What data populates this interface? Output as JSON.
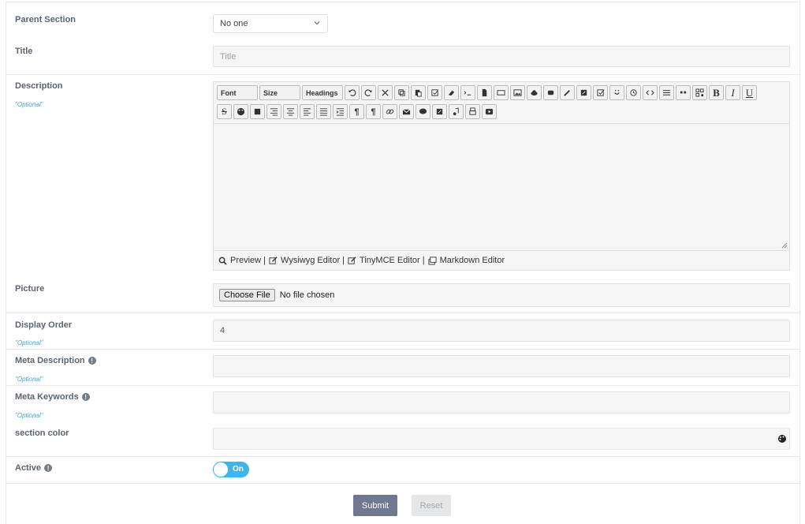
{
  "form": {
    "parent_section": {
      "label": "Parent Section",
      "value": "No one"
    },
    "title": {
      "label": "Title",
      "placeholder": "Title"
    },
    "description": {
      "label": "Description",
      "optional": "\"Optional\"",
      "toolbar": {
        "font": "Font",
        "size": "Size",
        "headings": "Headings"
      },
      "links": {
        "preview": "Preview |",
        "wysiwyg": "Wysiwyg Editor |",
        "tinymce": "TinyMCE Editor |",
        "markdown": "Markdown Editor"
      }
    },
    "picture": {
      "label": "Picture",
      "button": "Choose File",
      "status": "No file chosen"
    },
    "display_order": {
      "label": "Display Order",
      "optional": "\"Optional\"",
      "value": "4"
    },
    "meta_description": {
      "label": "Meta Description",
      "optional": "\"Optional\""
    },
    "meta_keywords": {
      "label": "Meta Keywords",
      "optional": "\"Optional\""
    },
    "section_color": {
      "label": "section color"
    },
    "active": {
      "label": "Active",
      "toggle": "On"
    },
    "info_glyph": "!",
    "submit": "Submit",
    "reset": "Reset"
  },
  "colors": {
    "accent": "#3fb5e9",
    "optional_text": "#3fa9d6",
    "submit_bg": "#6f7890"
  }
}
